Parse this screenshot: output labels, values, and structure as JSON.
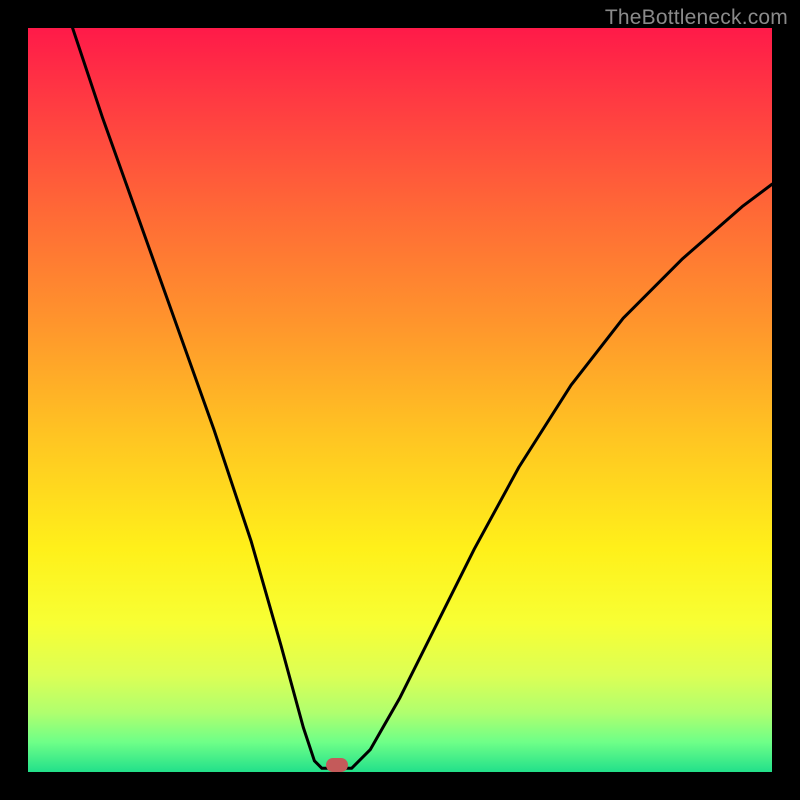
{
  "watermark": "TheBottleneck.com",
  "chart_data": {
    "type": "line",
    "title": "",
    "xlabel": "",
    "ylabel": "",
    "xlim": [
      0,
      100
    ],
    "ylim": [
      0,
      100
    ],
    "series": [
      {
        "name": "left-branch",
        "x": [
          6,
          10,
          15,
          20,
          25,
          30,
          34,
          37,
          38.5,
          39.5
        ],
        "y": [
          100,
          88,
          74,
          60,
          46,
          31,
          17,
          6,
          1.5,
          0.5
        ]
      },
      {
        "name": "bottom-flat",
        "x": [
          39.5,
          43.5
        ],
        "y": [
          0.5,
          0.5
        ]
      },
      {
        "name": "right-branch",
        "x": [
          43.5,
          46,
          50,
          55,
          60,
          66,
          73,
          80,
          88,
          96,
          100
        ],
        "y": [
          0.5,
          3,
          10,
          20,
          30,
          41,
          52,
          61,
          69,
          76,
          79
        ]
      }
    ],
    "marker": {
      "x": 41.5,
      "y": 0.9
    },
    "background_gradient": {
      "stops": [
        {
          "pos": 0.0,
          "color": "#ff1a49"
        },
        {
          "pos": 0.25,
          "color": "#ff6a36"
        },
        {
          "pos": 0.55,
          "color": "#ffc522"
        },
        {
          "pos": 0.8,
          "color": "#f7ff34"
        },
        {
          "pos": 1.0,
          "color": "#22e08a"
        }
      ]
    }
  }
}
